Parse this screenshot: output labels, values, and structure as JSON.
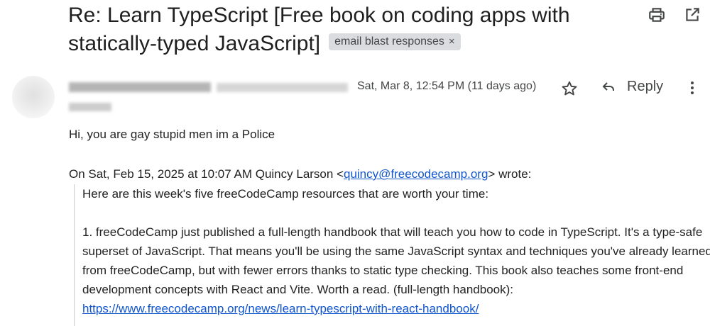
{
  "subject": {
    "title": "Re: Learn TypeScript [Free book on coding apps with statically-typed JavaScript]",
    "label_chip": "email blast responses",
    "label_remove": "×"
  },
  "toolbar": {
    "print_icon": "printer-icon",
    "new_window_icon": "open-in-new-window-icon"
  },
  "message": {
    "date": "Sat, Mar 8, 12:54 PM (11 days ago)",
    "reply_label": "Reply",
    "icons": [
      "star-icon",
      "reply-arrow-icon",
      "more-vert-icon"
    ],
    "body": "Hi, you are gay stupid men im a Police",
    "quote_header": {
      "prefix": "On Sat, Feb 15, 2025 at 10:07 AM Quincy Larson <",
      "email": "quincy@freecodecamp.org",
      "suffix": "> wrote:"
    },
    "quote": {
      "line1": "Here are this week's five freeCodeCamp resources that are worth your time:",
      "para1_text": "1. freeCodeCamp just published a full-length handbook that will teach you how to code in TypeScript. It's a type-safe superset of JavaScript. That means you'll be using the same JavaScript syntax and techniques you've already learned from freeCodeCamp, but with fewer errors thanks to static type checking. This book also teaches some front-end development concepts with React and Vite. Worth a read. (full-length handbook): ",
      "para1_link": "https://www.freecodecamp.org/news/learn-typescript-with-react-handbook/"
    }
  }
}
